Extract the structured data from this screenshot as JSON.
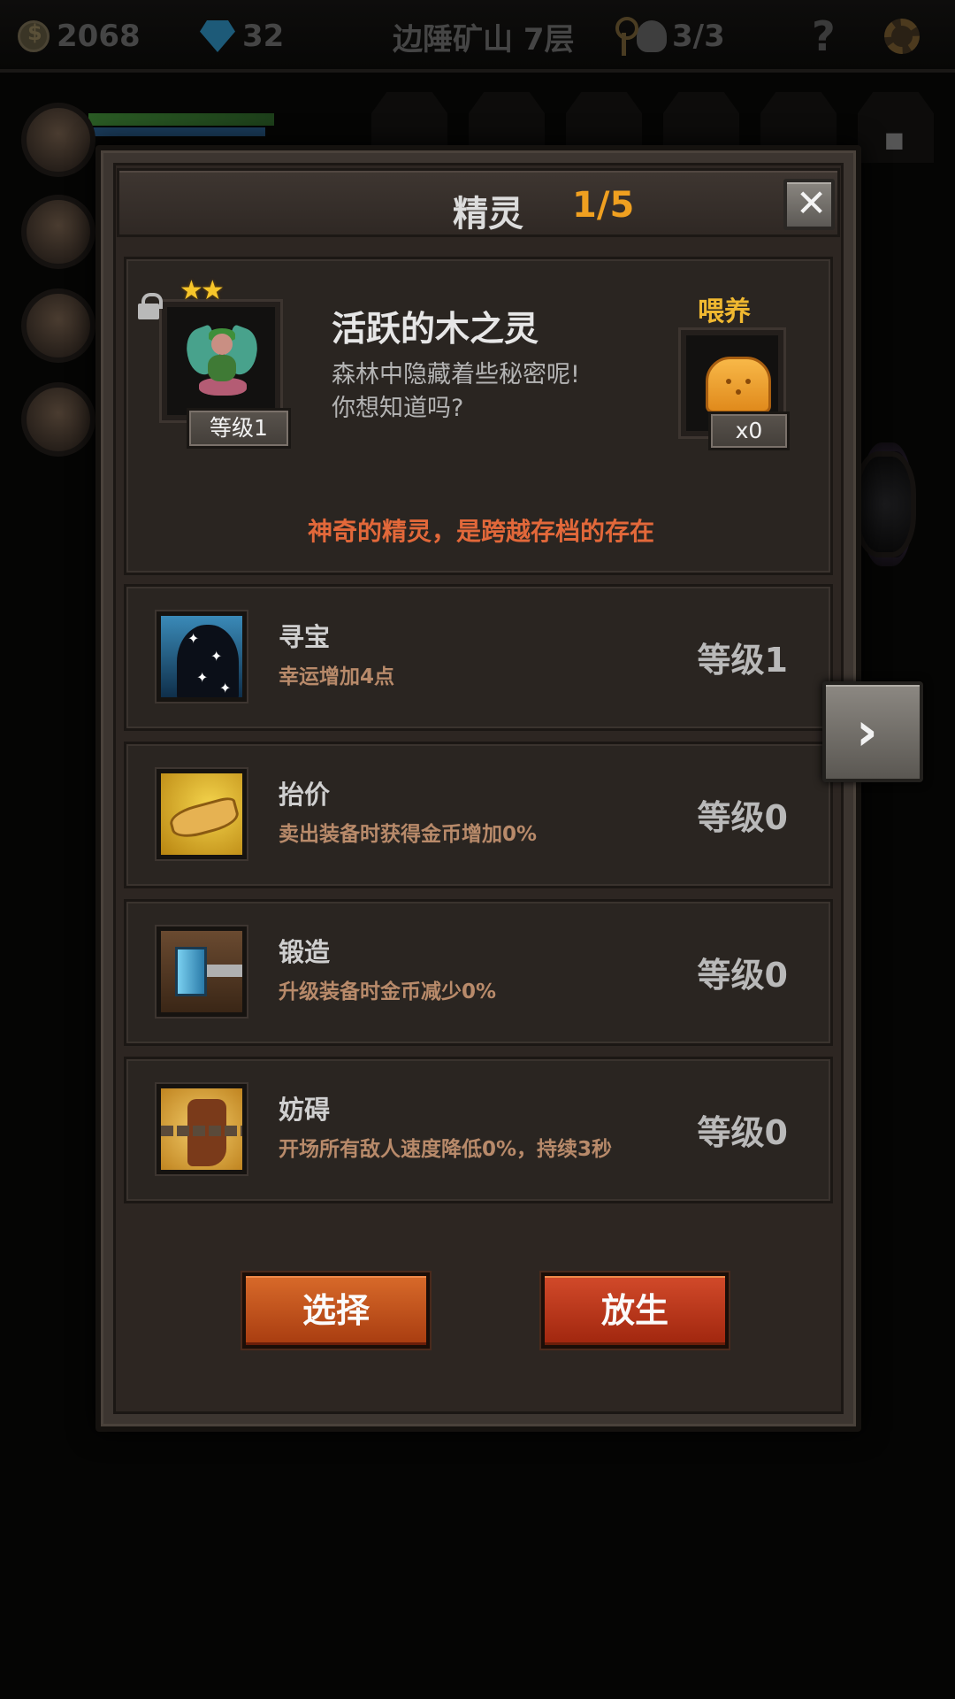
{
  "topbar": {
    "coins": "2068",
    "gems": "32",
    "location": "边陲矿山 7层",
    "skulls": "3/3",
    "help": "?"
  },
  "dialog": {
    "title": "精灵",
    "count": "1/5",
    "close_label": "✕"
  },
  "spirit": {
    "stars": "★★",
    "level_label": "等级1",
    "name": "活跃的木之灵",
    "description_line1": "森林中隐藏着些秘密呢!",
    "description_line2": "你想知道吗?",
    "feed_label": "喂养",
    "food_count": "x0",
    "tagline": "神奇的精灵，是跨越存档的存在"
  },
  "skills": [
    {
      "name": "寻宝",
      "desc": "幸运增加4点",
      "level": "等级1",
      "icon": "treasure-icon"
    },
    {
      "name": "抬价",
      "desc": "卖出装备时获得金币增加0%",
      "level": "等级0",
      "icon": "hand-coin-icon"
    },
    {
      "name": "锻造",
      "desc": "升级装备时金币减少0%",
      "level": "等级0",
      "icon": "hammer-icon"
    },
    {
      "name": "妨碍",
      "desc": "开场所有敌人速度降低0%，持续3秒",
      "level": "等级0",
      "icon": "chained-boot-icon"
    }
  ],
  "buttons": {
    "select": "选择",
    "release": "放生",
    "next": "›"
  },
  "colors": {
    "accent_orange": "#f0a020",
    "tagline": "#e2683a",
    "feed": "#f0b830",
    "button_select": "#c0521c",
    "button_release": "#b8361a"
  }
}
